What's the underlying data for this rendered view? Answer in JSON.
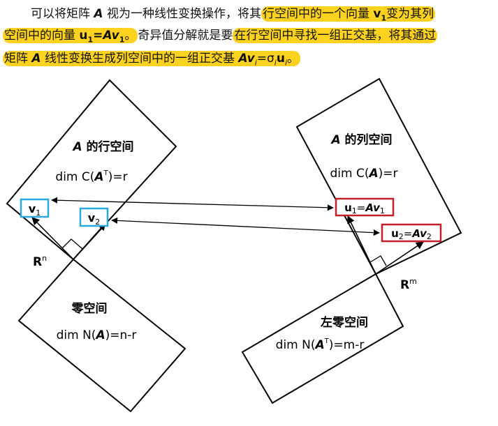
{
  "paragraph": {
    "line1": {
      "pre": "可以将矩阵 ",
      "A": "A",
      "mid": " 视为一种线性变换操作，将其",
      "hl": "行空间中的一个向量 ",
      "v": "v",
      "sub1": "1",
      "post": "变为其列"
    },
    "line2": {
      "hl_a": "空间中的向量 ",
      "u": "u",
      "sub1": "1",
      "eq": "=",
      "Av": "Av",
      "sub2": "1",
      "end": "。",
      "mid": "奇异值分解就是要",
      "hl_b": "在行空间中寻找一组正交基，将其通过"
    },
    "line3": {
      "hl_a": "矩阵 ",
      "A": "A",
      "hl_b": " 线性变换生成列空间中的一组正交基 ",
      "Av": "Av",
      "i": "i",
      "eq": "=σ",
      "i2": "i",
      "u": "u",
      "i3": "i",
      "end": "。"
    }
  },
  "diagram": {
    "row_space": {
      "A": "A",
      "title": " 的行空间",
      "dim_pre": "dim C(",
      "A2": "A",
      "sup": "T",
      "dim_post": ")=r"
    },
    "null_space": {
      "title": "零空间",
      "dim_pre": "dim N(",
      "A": "A",
      "dim_post": ")=n-r"
    },
    "col_space": {
      "A": "A",
      "title": " 的列空间",
      "dim_pre": "dim C(",
      "A2": "A",
      "dim_post": ")=r"
    },
    "left_null_space": {
      "title": "左零空间",
      "dim_pre": "dim N(",
      "A": "A",
      "sup": "T",
      "dim_post": ")=m-r"
    },
    "Rn": {
      "R": "R",
      "sup": "n"
    },
    "Rm": {
      "R": "R",
      "sup": "m"
    },
    "v1": {
      "v": "v",
      "sub": "1"
    },
    "v2": {
      "v": "v",
      "sub": "2"
    },
    "u1": {
      "u": "u",
      "sub": "1",
      "eq": "=",
      "Av": "Av",
      "sub2": "1"
    },
    "u2": {
      "u": "u",
      "sub": "2",
      "eq": "=",
      "Av": "Av",
      "sub2": "2"
    }
  },
  "colors": {
    "highlight": "#ffd21f",
    "v_box": "#29a8e0",
    "u_box": "#c0202a",
    "lines": "#000000"
  }
}
